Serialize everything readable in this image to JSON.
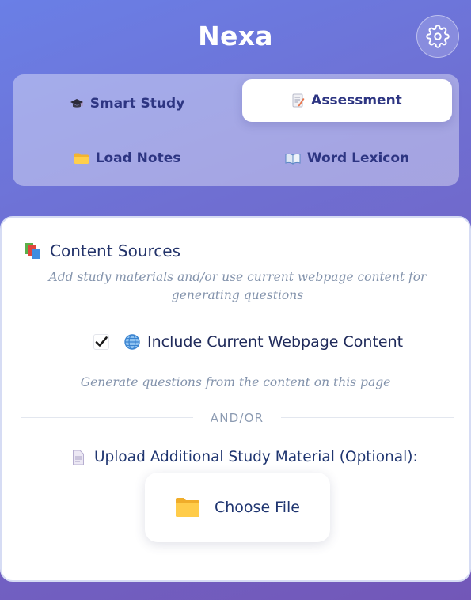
{
  "app": {
    "title": "Nexa"
  },
  "tabs": [
    {
      "label": "Smart Study",
      "icon": "graduation-cap-icon",
      "active": false
    },
    {
      "label": "Assessment",
      "icon": "memo-icon",
      "active": true
    },
    {
      "label": "Load Notes",
      "icon": "folder-icon",
      "active": false
    },
    {
      "label": "Word Lexicon",
      "icon": "open-book-icon",
      "active": false
    }
  ],
  "content_sources": {
    "title": "Content Sources",
    "subtitle": "Add study materials and/or use current webpage content for generating questions",
    "include_label": "Include Current Webpage Content",
    "include_checked": true,
    "include_hint": "Generate questions from the content on this page",
    "divider_text": "AND/OR",
    "upload_label": "Upload Additional Study Material (Optional):",
    "choose_file_label": "Choose File"
  },
  "colors": {
    "accent": "#2d3582",
    "text_dark": "#1f3570",
    "muted": "#8393ac"
  }
}
